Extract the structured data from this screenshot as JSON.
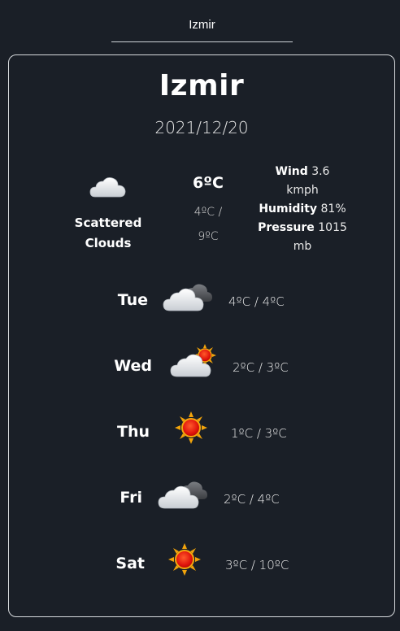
{
  "search": {
    "value": "Izmir",
    "placeholder": ""
  },
  "current": {
    "city": "Izmir",
    "date": "2021/12/20",
    "icon": "scattered-clouds-icon",
    "description_line1": "Scattered",
    "description_line2": "Clouds",
    "temp": "6ºC",
    "range_low": "4ºC /",
    "range_high": "9ºC",
    "wind_label": "Wind",
    "wind_value": "3.6",
    "wind_unit": "kmph",
    "humidity_label": "Humidity",
    "humidity_value": "81%",
    "pressure_label": "Pressure",
    "pressure_value": "1015",
    "pressure_unit": "mb"
  },
  "forecast": [
    {
      "day": "Tue",
      "icon": "broken-clouds-icon",
      "temps": "4ºC / 4ºC"
    },
    {
      "day": "Wed",
      "icon": "partly-sunny-icon",
      "temps": "2ºC / 3ºC"
    },
    {
      "day": "Thu",
      "icon": "sun-icon",
      "temps": "1ºC / 3ºC"
    },
    {
      "day": "Fri",
      "icon": "broken-clouds-icon",
      "temps": "2ºC / 4ºC"
    },
    {
      "day": "Sat",
      "icon": "sun-icon",
      "temps": "3ºC / 10ºC"
    }
  ]
}
